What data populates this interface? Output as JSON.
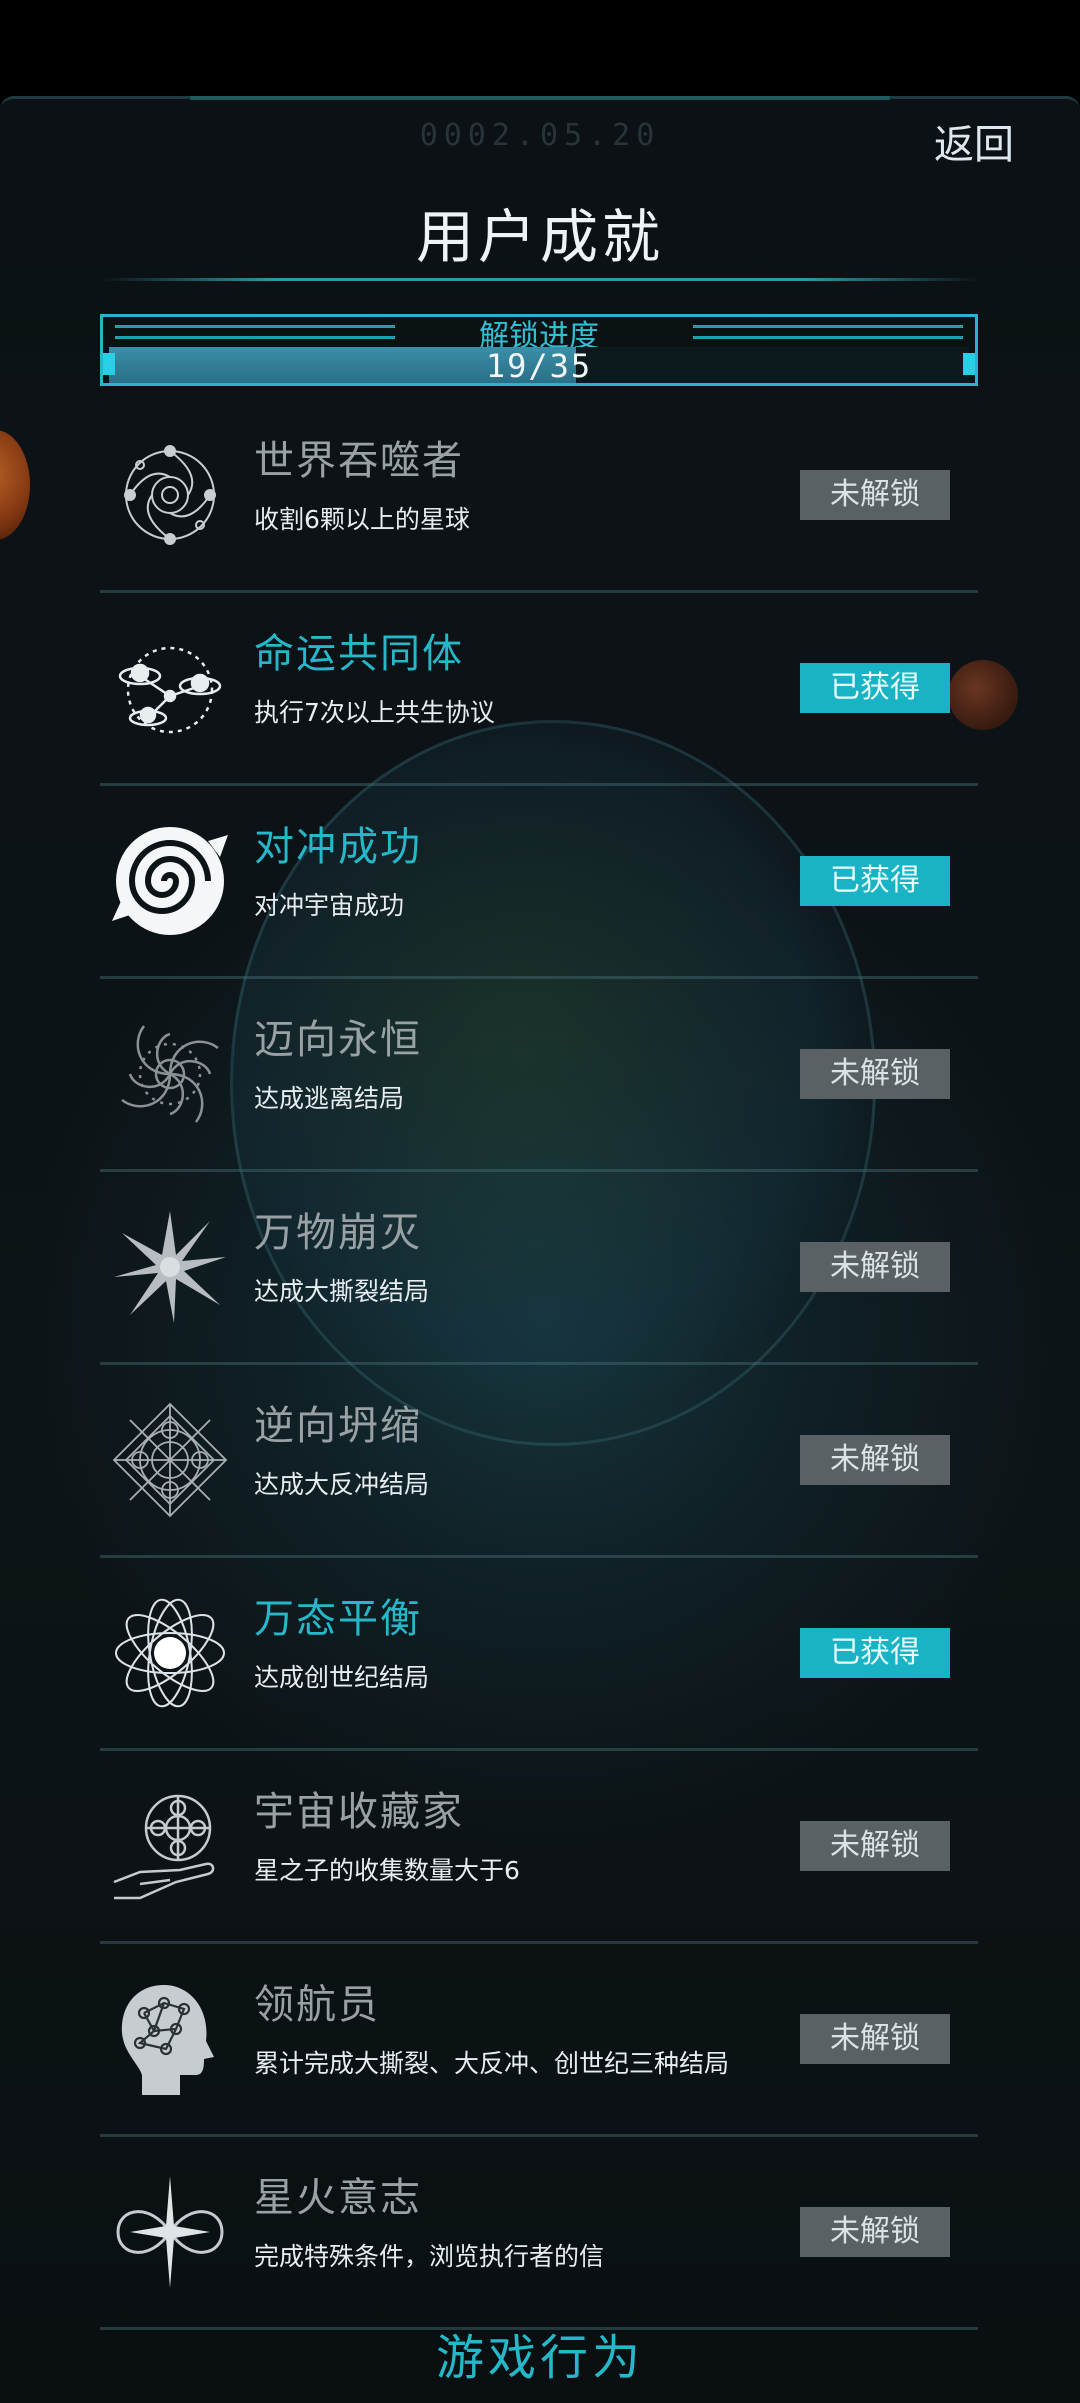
{
  "header": {
    "date": "0002.05.20",
    "back_label": "返回",
    "title": "用户成就"
  },
  "progress": {
    "label": "解锁进度",
    "count_text": "19/35",
    "fraction": 0.5429
  },
  "achievements": [
    {
      "name": "世界吞噬者",
      "desc": "收割6颗以上的星球",
      "status": "未解锁",
      "unlocked": false,
      "icon": "world-devourer-icon"
    },
    {
      "name": "命运共同体",
      "desc": "执行7次以上共生协议",
      "status": "已获得",
      "unlocked": true,
      "icon": "shared-destiny-icon"
    },
    {
      "name": "对冲成功",
      "desc": "对冲宇宙成功",
      "status": "已获得",
      "unlocked": true,
      "icon": "spiral-swirl-icon"
    },
    {
      "name": "迈向永恒",
      "desc": "达成逃离结局",
      "status": "未解锁",
      "unlocked": false,
      "icon": "vortex-icon"
    },
    {
      "name": "万物崩灭",
      "desc": "达成大撕裂结局",
      "status": "未解锁",
      "unlocked": false,
      "icon": "burst-icon"
    },
    {
      "name": "逆向坍缩",
      "desc": "达成大反冲结局",
      "status": "未解锁",
      "unlocked": false,
      "icon": "mandala-icon"
    },
    {
      "name": "万态平衡",
      "desc": "达成创世纪结局",
      "status": "已获得",
      "unlocked": true,
      "icon": "atom-orbit-icon"
    },
    {
      "name": "宇宙收藏家",
      "desc": "星之子的收集数量大于6",
      "status": "未解锁",
      "unlocked": false,
      "icon": "hand-sphere-icon"
    },
    {
      "name": "领航员",
      "desc": "累计完成大撕裂、大反冲、创世纪三种结局",
      "status": "未解锁",
      "unlocked": false,
      "icon": "brain-head-icon"
    },
    {
      "name": "星火意志",
      "desc": "完成特殊条件，浏览执行者的信",
      "status": "未解锁",
      "unlocked": false,
      "icon": "infinity-star-icon"
    }
  ],
  "footer": {
    "label": "游戏行为"
  }
}
